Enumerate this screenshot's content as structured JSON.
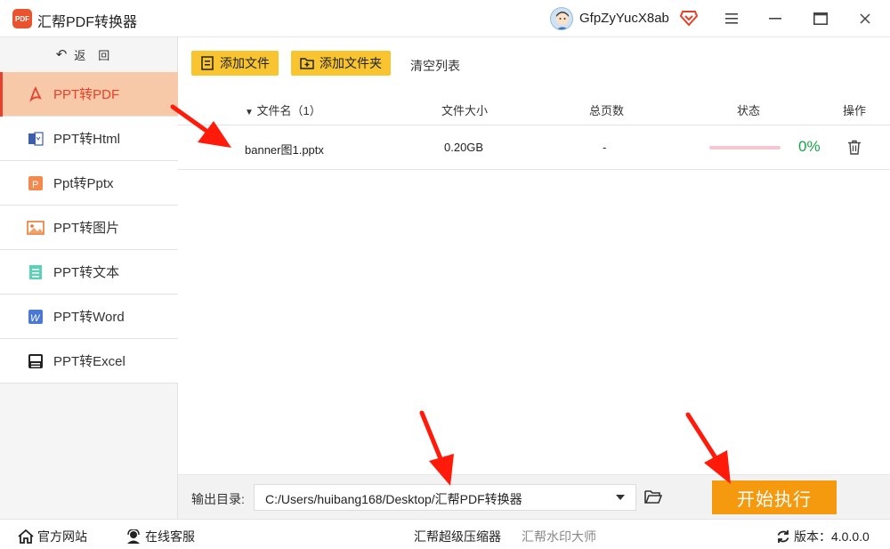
{
  "app": {
    "title": "汇帮PDF转换器",
    "logo_text": "PDF"
  },
  "user": {
    "name": "GfpZyYucX8ab"
  },
  "sidebar": {
    "back_label": "返回",
    "items": [
      {
        "label": "PPT转PDF"
      },
      {
        "label": "PPT转Html"
      },
      {
        "label": "Ppt转Pptx"
      },
      {
        "label": "PPT转图片"
      },
      {
        "label": "PPT转文本"
      },
      {
        "label": "PPT转Word"
      },
      {
        "label": "PPT转Excel"
      }
    ]
  },
  "toolbar": {
    "add_file": "添加文件",
    "add_folder": "添加文件夹",
    "clear_list": "清空列表"
  },
  "table": {
    "headers": {
      "name": "文件名（1）",
      "size": "文件大小",
      "pages": "总页数",
      "status": "状态",
      "action": "操作"
    },
    "rows": [
      {
        "name": "banner图1.pptx",
        "size": "0.20GB",
        "pages": "-",
        "progress": 0,
        "progress_text": "0%"
      }
    ]
  },
  "output": {
    "label": "输出目录:",
    "path": "C:/Users/huibang168/Desktop/汇帮PDF转换器"
  },
  "start_button": "开始执行",
  "footer": {
    "website": "官方网站",
    "support": "在线客服",
    "link1": "汇帮超级压缩器",
    "link2": "汇帮水印大师",
    "version": "版本：4.0.0.0"
  },
  "colors": {
    "accent": "#e8402a",
    "active_bg": "#f7c9a8",
    "button_yellow": "#f8c430",
    "start_orange": "#f59a0e",
    "progress_green": "#1aa34a"
  }
}
